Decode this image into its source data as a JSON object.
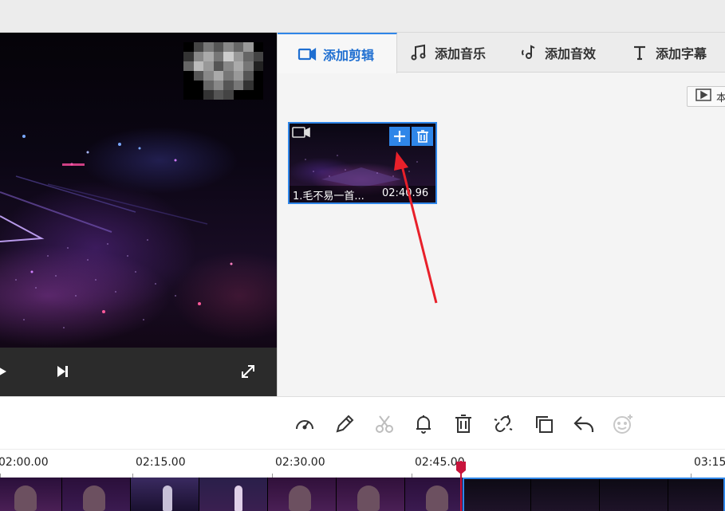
{
  "tabs": [
    {
      "label": "添加剪辑",
      "icon": "video-camera-icon",
      "active": true
    },
    {
      "label": "添加音乐",
      "icon": "music-note-icon",
      "active": false
    },
    {
      "label": "添加音效",
      "icon": "sound-effect-icon",
      "active": false
    },
    {
      "label": "添加字幕",
      "icon": "text-t-icon",
      "active": false
    }
  ],
  "local_button": {
    "label": "本"
  },
  "clip": {
    "name": "1.毛不易一首...",
    "duration": "02:40.96"
  },
  "timeline": {
    "ticks": [
      "02:00.00",
      "02:15.00",
      "02:30.00",
      "02:45.00",
      "03:15"
    ]
  },
  "colors": {
    "accent": "#2f86e8",
    "tab_active_text": "#1f6fd1",
    "playhead": "#c8143c",
    "annotation_arrow": "#e8202a"
  },
  "toolbar_icons": [
    "speed-gauge-icon",
    "pencil-edit-icon",
    "scissors-cut-icon",
    "bell-marker-icon",
    "trash-icon",
    "unlink-icon",
    "copy-icon",
    "undo-icon",
    "face-sticker-icon"
  ]
}
